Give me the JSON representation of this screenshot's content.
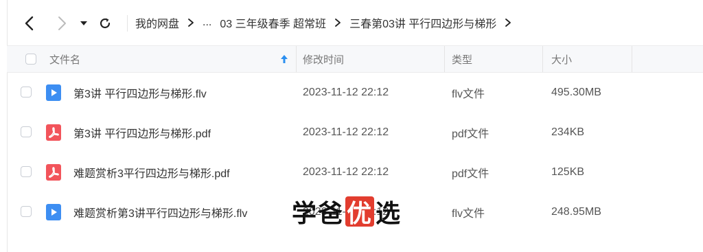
{
  "toolbar": {
    "back_icon": "chevron-left-icon",
    "forward_icon": "chevron-right-icon",
    "history_dropdown_icon": "caret-down-icon",
    "refresh_icon": "refresh-icon"
  },
  "breadcrumb": {
    "items": [
      "我的网盘",
      "...",
      "03 三年级春季 超常班",
      "三春第03讲 平行四边形与梯形"
    ]
  },
  "table": {
    "columns": {
      "name": "文件名",
      "modified": "修改时间",
      "type": "类型",
      "size": "大小"
    },
    "sort_icon": "arrow-up-icon",
    "rows": [
      {
        "name": "第3讲 平行四边形与梯形.flv",
        "modified": "2023-11-12 22:12",
        "type": "flv文件",
        "size": "495.30MB",
        "icon": "video-file-icon"
      },
      {
        "name": "第3讲 平行四边形与梯形.pdf",
        "modified": "2023-11-12 22:12",
        "type": "pdf文件",
        "size": "234KB",
        "icon": "pdf-file-icon"
      },
      {
        "name": "难题赏析3平行四边形与梯形.pdf",
        "modified": "2023-11-12 22:12",
        "type": "pdf文件",
        "size": "125KB",
        "icon": "pdf-file-icon"
      },
      {
        "name": "难题赏析第3讲平行四边形与梯形.flv",
        "modified": "2023-11-12 22:12",
        "type": "flv文件",
        "size": "248.95MB",
        "icon": "video-file-icon"
      }
    ]
  },
  "watermark": {
    "part1": "学爸",
    "highlight": "优",
    "part2": "选"
  },
  "colors": {
    "video": "#3d8ef2",
    "pdf": "#f2545b",
    "sort_arrow": "#2b8ff0",
    "watermark_box": "#e23d2f"
  }
}
